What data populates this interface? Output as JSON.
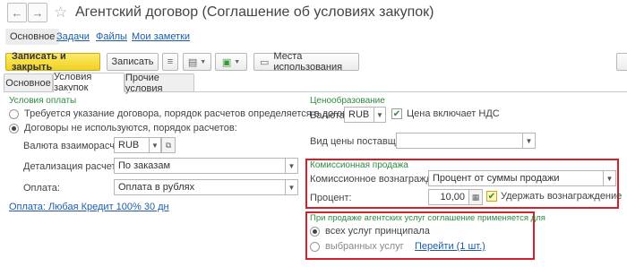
{
  "header": {
    "title": "Агентский договор (Соглашение об условиях закупок)"
  },
  "nav": {
    "main": "Основное",
    "tasks": "Задачи",
    "files": "Файлы",
    "notes": "Мои заметки"
  },
  "toolbar": {
    "save_close": "Записать и закрыть",
    "save": "Записать",
    "usage": "Места использования"
  },
  "tabs": {
    "main": "Основное",
    "purchase": "Условия закупок",
    "other": "Прочие условия"
  },
  "payment": {
    "section": "Условия оплаты",
    "radio1": "Требуется указание договора, порядок расчетов определяется в договоре",
    "radio2": "Договоры не используются, порядок расчетов:",
    "currency_label": "Валюта взаиморасчетов:",
    "currency_value": "RUB",
    "detail_label": "Детализация расчетов:",
    "detail_value": "По заказам",
    "pay_label": "Оплата:",
    "pay_value": "Оплата в рублях",
    "terms_link": "Оплата: Любая Кредит 100% 30 дн"
  },
  "pricing": {
    "section": "Ценообразование",
    "currency_label": "Валюта:",
    "currency_value": "RUB",
    "vat_label": "Цена включает НДС",
    "price_type_label": "Вид цены поставщика:"
  },
  "commission": {
    "section": "Комиссионная продажа",
    "reward_label": "Комиссионное вознаграждение:",
    "reward_value": "Процент от суммы продажи",
    "percent_label": "Процент:",
    "percent_value": "10,00",
    "withhold_label": "Удержать вознаграждение"
  },
  "agency": {
    "section": "При продаже агентских услуг соглашение применяется для",
    "all_label": "всех услуг принципала",
    "selected_label": "выбранных услуг",
    "goto_link": "Перейти (1 шт.)"
  }
}
